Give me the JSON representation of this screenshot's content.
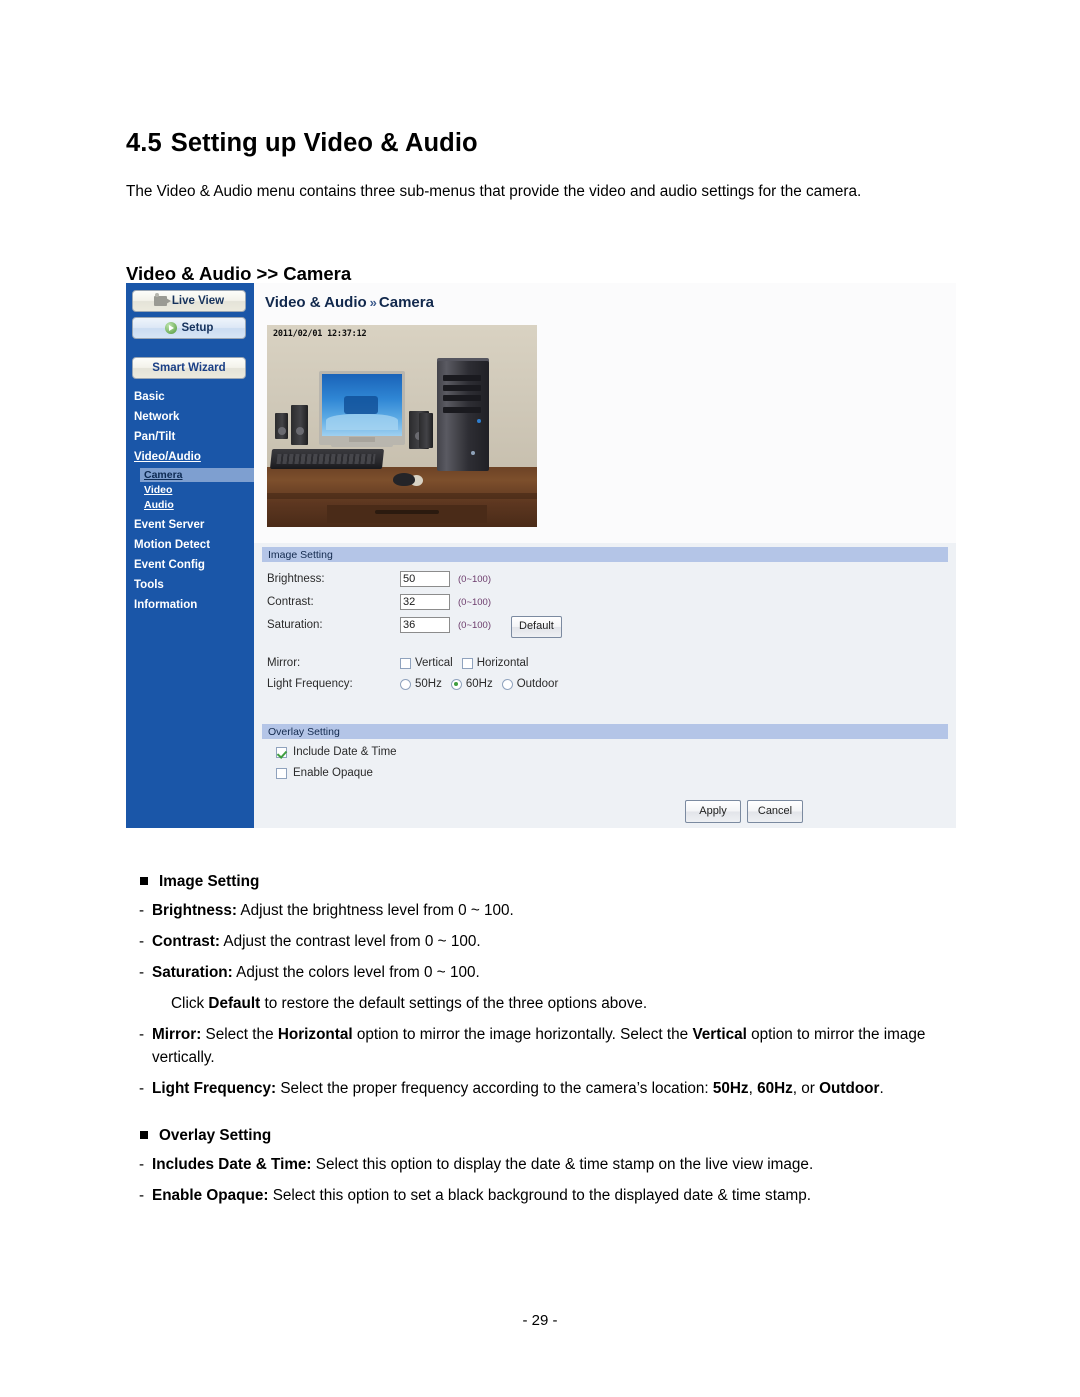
{
  "document": {
    "heading_number": "4.5",
    "heading_title": "Setting up Video & Audio",
    "intro": "The Video & Audio menu contains three sub-menus that provide the video and audio settings for the camera.",
    "subheading": "Video & Audio >> Camera",
    "page_number": "- 29 -"
  },
  "screenshot": {
    "sidebar": {
      "live_view_button": "Live View",
      "setup_button": "Setup",
      "smart_wizard_button": "Smart Wizard",
      "items": [
        {
          "label": "Basic",
          "type": "link"
        },
        {
          "label": "Network",
          "type": "link"
        },
        {
          "label": "Pan/Tilt",
          "type": "link"
        },
        {
          "label": "Video/Audio",
          "type": "link"
        }
      ],
      "sub_items": [
        {
          "label": "Camera",
          "active": true
        },
        {
          "label": "Video",
          "active": false
        },
        {
          "label": "Audio",
          "active": false
        }
      ],
      "items_after": [
        {
          "label": "Event Server"
        },
        {
          "label": "Motion Detect"
        },
        {
          "label": "Event Config"
        },
        {
          "label": "Tools"
        },
        {
          "label": "Information"
        }
      ]
    },
    "breadcrumb": {
      "root": "Video & Audio",
      "separator": "»",
      "current": "Camera"
    },
    "preview": {
      "timestamp": "2011/02/01 12:37:12"
    },
    "image_setting": {
      "section_title": "Image Setting",
      "brightness_label": "Brightness:",
      "brightness_value": "50",
      "brightness_hint": "(0~100)",
      "contrast_label": "Contrast:",
      "contrast_value": "32",
      "contrast_hint": "(0~100)",
      "saturation_label": "Saturation:",
      "saturation_value": "36",
      "saturation_hint": "(0~100)",
      "default_button": "Default",
      "mirror_label": "Mirror:",
      "mirror_vertical": "Vertical",
      "mirror_vertical_checked": false,
      "mirror_horizontal": "Horizontal",
      "mirror_horizontal_checked": false,
      "light_frequency_label": "Light Frequency:",
      "light_frequency_options": [
        "50Hz",
        "60Hz",
        "Outdoor"
      ],
      "light_frequency_selected": "60Hz"
    },
    "overlay_setting": {
      "section_title": "Overlay Setting",
      "include_date_time": "Include Date & Time",
      "include_date_time_checked": true,
      "enable_opaque": "Enable Opaque",
      "enable_opaque_checked": false
    },
    "actions": {
      "apply_button": "Apply",
      "cancel_button": "Cancel"
    }
  },
  "body": {
    "image_setting_heading": "Image Setting",
    "overlay_setting_heading": "Overlay Setting",
    "bullets": [
      {
        "term": "Brightness:",
        "text": " Adjust the brightness level from 0 ~ 100."
      },
      {
        "term": "Contrast:",
        "text": " Adjust the contrast level from 0 ~ 100."
      },
      {
        "term": "Saturation:",
        "text": " Adjust the colors level from 0 ~ 100."
      }
    ],
    "default_note_pre": "Click ",
    "default_note_bold": "Default",
    "default_note_post": " to restore the default settings of the three options above.",
    "mirror_term": "Mirror:",
    "mirror_t1": " Select the ",
    "mirror_b1": "Horizontal",
    "mirror_t2": " option to mirror the image horizontally. Select the ",
    "mirror_b2": "Vertical",
    "mirror_t3": " option to mirror the image vertically.",
    "light_term": "Light Frequency:",
    "light_t1": " Select the proper frequency according to the camera’s location: ",
    "light_b1": "50Hz",
    "light_t2": ", ",
    "light_b2": "60Hz",
    "light_t3": ", or ",
    "light_b3": "Outdoor",
    "light_t4": ".",
    "overlay_bullets": [
      {
        "term": "Includes Date & Time:",
        "text": " Select this option to display the date & time stamp on the live view image."
      },
      {
        "term": "Enable Opaque:",
        "text": " Select this option to set a black background to the displayed date & time stamp."
      }
    ]
  }
}
